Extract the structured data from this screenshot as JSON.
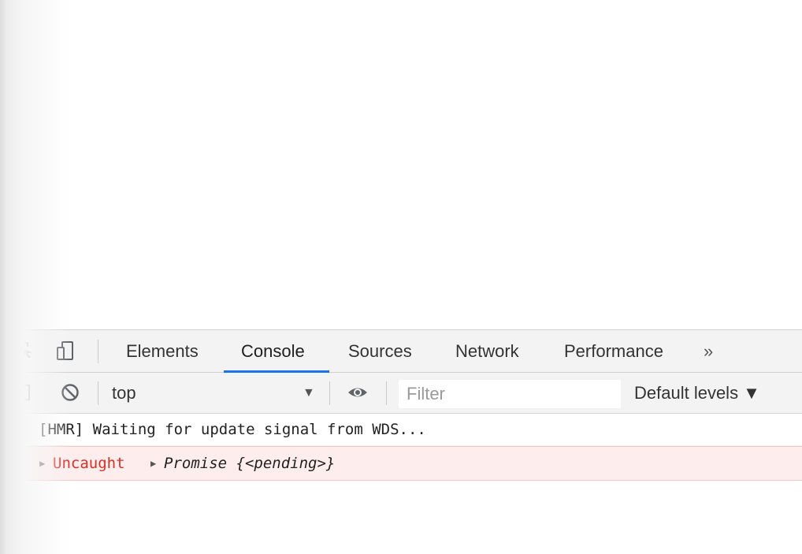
{
  "devtools": {
    "tabs": [
      {
        "label": "Elements"
      },
      {
        "label": "Console"
      },
      {
        "label": "Sources"
      },
      {
        "label": "Network"
      },
      {
        "label": "Performance"
      }
    ],
    "active_tab": "Console",
    "more_tabs_label": "»"
  },
  "toolbar": {
    "context": "top",
    "filter_placeholder": "Filter",
    "levels_label": "Default levels ▼"
  },
  "console": {
    "log_message": "[HMR] Waiting for update signal from WDS...",
    "error": {
      "label": "Uncaught",
      "value": "Promise {<pending>}"
    },
    "prompt_symbol": "›"
  },
  "colors": {
    "active_tab_underline": "#1a73e8",
    "error_text": "#d93026",
    "error_background": "#fdeded",
    "prompt": "#1a73e8"
  },
  "icons": [
    "inspect-element-icon",
    "device-toolbar-icon",
    "toggle-sidebar-icon",
    "clear-console-icon",
    "live-expression-eye-icon",
    "error-icon"
  ]
}
